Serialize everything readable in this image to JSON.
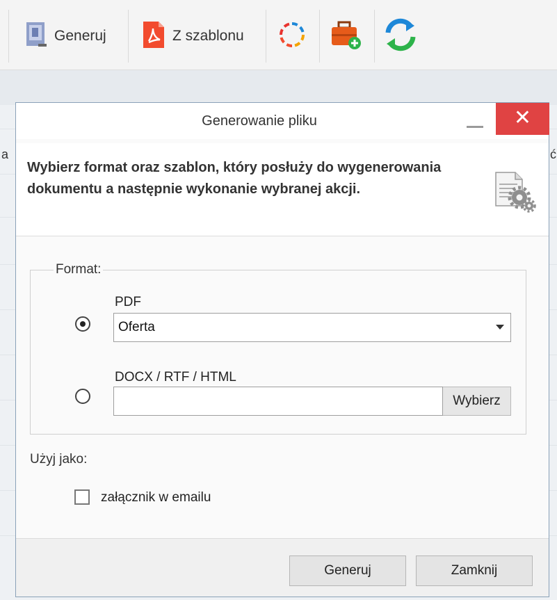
{
  "toolbar": {
    "generate_label": "Generuj",
    "template_label": "Z szablonu",
    "icons": [
      "generate-document-icon",
      "pdf-icon",
      "convert-icon",
      "briefcase-add-icon",
      "refresh-icon"
    ]
  },
  "background": {
    "left_glyph": "a",
    "right_glyph": "ć"
  },
  "dialog": {
    "title": "Generowanie pliku",
    "close_symbol": "✕",
    "instruction": "Wybierz format oraz szablon, który posłuży do wygenerowania dokumentu a następnie wykonanie wybranej akcji.",
    "format_group_label": "Format:",
    "pdf_option": {
      "label": "PDF",
      "selected": true,
      "template_value": "Oferta"
    },
    "docx_option": {
      "label": "DOCX / RTF / HTML",
      "selected": false,
      "path_value": "",
      "browse_label": "Wybierz"
    },
    "use_as_label": "Użyj jako:",
    "attachment_checkbox": {
      "label": "załącznik w emailu",
      "checked": false
    },
    "generate_button": "Generuj",
    "close_button": "Zamknij"
  },
  "colors": {
    "close_button_bg": "#e04343",
    "pdf_icon": "#f24b2e",
    "refresh_green": "#2db34a",
    "refresh_blue": "#1e88d8"
  }
}
